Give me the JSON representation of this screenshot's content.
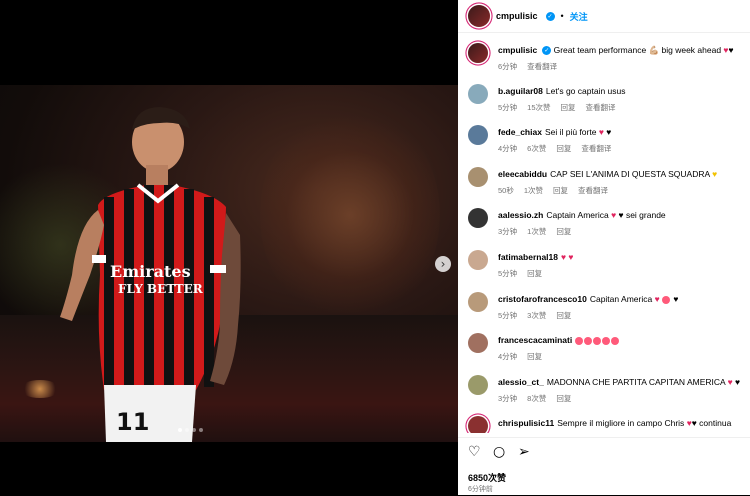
{
  "header": {
    "username": "cmpulisic",
    "separator": "•",
    "follow_label": "关注"
  },
  "icons": {
    "verified": "verified-badge-icon",
    "next": "chevron-right-icon",
    "like": "heart-outline-icon",
    "comment": "comment-bubble-icon",
    "share": "paper-plane-icon"
  },
  "media": {
    "image_desc_icon": "photo",
    "carousel_dots": 4,
    "active_dot": 0
  },
  "caption": {
    "username": "cmpulisic",
    "text": "Great team performance 💪🏼 big week ahead",
    "time": "6分钟",
    "translate": "查看翻译"
  },
  "comments": [
    {
      "username": "b.aguilar08",
      "text": "Let's go captain usus",
      "time": "5分钟",
      "likes": "15次赞",
      "reply": "回复",
      "translate": "查看翻译"
    },
    {
      "username": "fede_chiax",
      "text": "Sei il più forte",
      "time": "4分钟",
      "likes": "6次赞",
      "reply": "回复",
      "translate": "查看翻译"
    },
    {
      "username": "eleecabiddu",
      "text": "CAP SEI L'ANIMA DI QUESTA SQUADRA",
      "time": "50秒",
      "likes": "1次赞",
      "reply": "回复",
      "translate": "查看翻译"
    },
    {
      "username": "aalessio.zh",
      "text": "Captain America",
      "text2": "sei grande",
      "time": "3分钟",
      "likes": "1次赞",
      "reply": "回复"
    },
    {
      "username": "fatimabernal18",
      "text": "",
      "time": "5分钟",
      "reply": "回复"
    },
    {
      "username": "cristofarofrancesco10",
      "text": "Capitan America",
      "time": "5分钟",
      "likes": "3次赞",
      "reply": "回复"
    },
    {
      "username": "francescacaminati",
      "text": "",
      "time": "4分钟",
      "reply": "回复"
    },
    {
      "username": "alessio_ct_",
      "text": "MADONNA CHE PARTITA CAPITAN AMERICA",
      "time": "3分钟",
      "likes": "8次赞",
      "reply": "回复"
    },
    {
      "username": "chrispulisic11",
      "text": "Sempre il migliore in campo Chris",
      "text2": "continua"
    }
  ],
  "footer": {
    "likes": "6850次赞",
    "time": "6分钟前"
  },
  "colors": {
    "accent": "#0095f6",
    "heart": "#e0245e",
    "muted": "#737373"
  }
}
